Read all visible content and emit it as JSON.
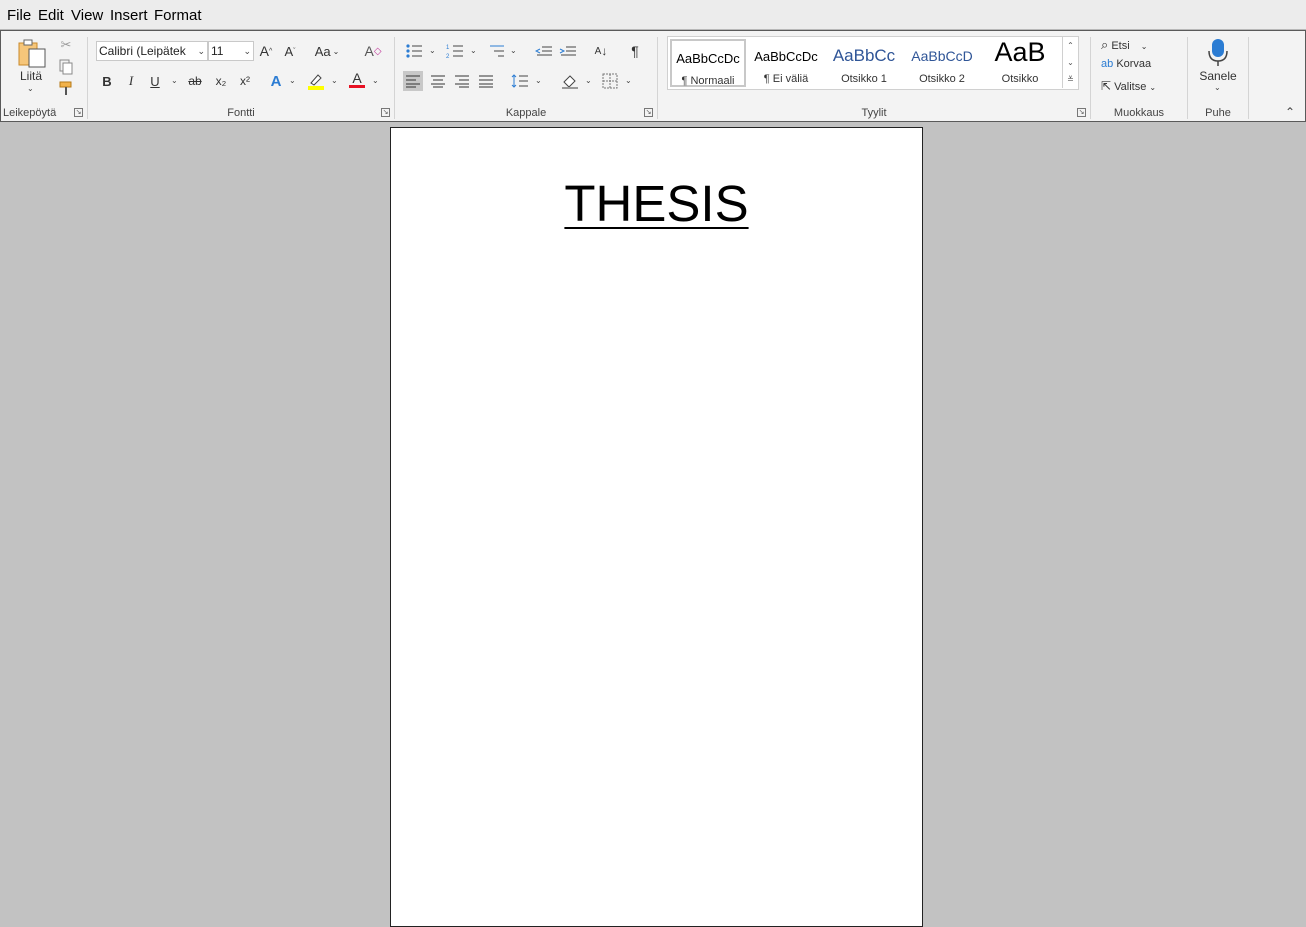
{
  "menu": {
    "items": [
      "File",
      "Edit",
      "View",
      "Insert",
      "Format"
    ]
  },
  "ribbon": {
    "clipboard": {
      "paste_label": "Liitä",
      "group_label": "Leikepöytä"
    },
    "font": {
      "font_name": "Calibri (Leipätek",
      "font_size": "11",
      "change_case_label": "Aa",
      "bold": "B",
      "italic": "I",
      "underline": "U",
      "strikethrough": "ab",
      "subscript": "x₂",
      "superscript": "x²",
      "text_effects": "A",
      "font_color": "A",
      "group_label": "Fontti"
    },
    "paragraph": {
      "pilcrow": "¶",
      "group_label": "Kappale"
    },
    "styles": {
      "tiles": [
        {
          "preview": "AaBbCcDc",
          "name": "¶ Normaali"
        },
        {
          "preview": "AaBbCcDc",
          "name": "¶ Ei väliä"
        },
        {
          "preview": "AaBbCc",
          "name": "Otsikko 1"
        },
        {
          "preview": "AaBbCcD",
          "name": "Otsikko 2"
        },
        {
          "preview": "AaB",
          "name": "Otsikko"
        }
      ],
      "group_label": "Tyylit"
    },
    "editing": {
      "find_label": "Etsi",
      "replace_label": "Korvaa",
      "select_label": "Valitse",
      "group_label": "Muokkaus"
    },
    "voice": {
      "dictate_label": "Sanele",
      "group_label": "Puhe"
    },
    "colors": {
      "highlight": "#ffff00",
      "font_color": "#e81123",
      "accent": "#2b7cd3",
      "heading_blue": "#2f5597"
    }
  },
  "document": {
    "title": "THESIS"
  }
}
